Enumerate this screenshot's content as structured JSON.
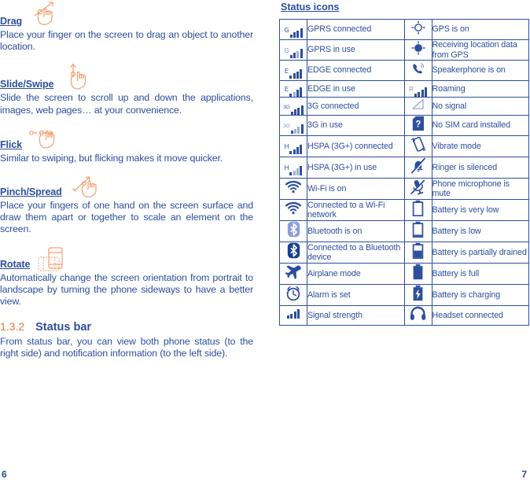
{
  "left_column": {
    "sections": [
      {
        "id": "drag",
        "term": "Drag",
        "icon": "drag-gesture-icon",
        "body": "Place your finger on the screen to drag an object to another location."
      },
      {
        "id": "slide-swipe",
        "term": "Slide/Swipe",
        "icon": "slide-swipe-gesture-icon",
        "body": "Slide the screen to scroll up and down the applications, images, web pages… at your convenience."
      },
      {
        "id": "flick",
        "term": "Flick",
        "icon": "flick-gesture-icon",
        "body": "Similar to swiping, but flicking makes it move quicker."
      },
      {
        "id": "pinch-spread",
        "term": "Pinch/Spread",
        "icon": "pinch-spread-gesture-icon",
        "body": "Place your fingers of one hand on the screen surface and draw them apart or together to scale an element on the screen."
      },
      {
        "id": "rotate",
        "term": "Rotate",
        "icon": "rotate-gesture-icon",
        "body": "Automatically change the screen orientation from portrait to landscape by turning the phone sideways to have a better view."
      }
    ],
    "subsection": {
      "number": "1.3.2",
      "title": "Status bar",
      "body": "From status bar, you can view both phone status (to the right side) and notification information (to the left side)."
    }
  },
  "right_column": {
    "heading": "Status icons",
    "table_rows": [
      {
        "left_icon": "gprs-connected-icon",
        "left_label": "GPRS connected",
        "right_icon": "gps-on-icon",
        "right_label": "GPS is on"
      },
      {
        "left_icon": "gprs-in-use-icon",
        "left_label": "GPRS in use",
        "right_icon": "gps-receiving-icon",
        "right_label": "Receiving location data from GPS"
      },
      {
        "left_icon": "edge-connected-icon",
        "left_label": "EDGE connected",
        "right_icon": "speakerphone-icon",
        "right_label": "Speakerphone is on"
      },
      {
        "left_icon": "edge-in-use-icon",
        "left_label": "EDGE in use",
        "right_icon": "roaming-icon",
        "right_label": "Roaming"
      },
      {
        "left_icon": "3g-connected-icon",
        "left_label": "3G connected",
        "right_icon": "no-signal-icon",
        "right_label": "No signal"
      },
      {
        "left_icon": "3g-in-use-icon",
        "left_label": "3G in use",
        "right_icon": "no-sim-card-icon",
        "right_label": "No SIM card installed"
      },
      {
        "left_icon": "hspa-connected-icon",
        "left_label": "HSPA (3G+) connected",
        "right_icon": "vibrate-mode-icon",
        "right_label": "Vibrate mode"
      },
      {
        "left_icon": "hspa-in-use-icon",
        "left_label": "HSPA (3G+) in use",
        "right_icon": "ringer-silenced-icon",
        "right_label": "Ringer is silenced"
      },
      {
        "left_icon": "wifi-on-icon",
        "left_label": "Wi-Fi is on",
        "right_icon": "microphone-mute-icon",
        "right_label": "Phone microphone is mute"
      },
      {
        "left_icon": "wifi-connected-icon",
        "left_label": "Connected to a Wi-Fi network",
        "right_icon": "battery-very-low-icon",
        "right_label": "Battery is very low"
      },
      {
        "left_icon": "bluetooth-on-icon",
        "left_label": "Bluetooth is on",
        "right_icon": "battery-low-icon",
        "right_label": "Battery is low"
      },
      {
        "left_icon": "bluetooth-connected-icon",
        "left_label": "Connected to a Bluetooth device",
        "right_icon": "battery-partial-icon",
        "right_label": "Battery is partially drained"
      },
      {
        "left_icon": "airplane-mode-icon",
        "left_label": "Airplane mode",
        "right_icon": "battery-full-icon",
        "right_label": "Battery is full"
      },
      {
        "left_icon": "alarm-set-icon",
        "left_label": "Alarm is set",
        "right_icon": "battery-charging-icon",
        "right_label": "Battery is charging"
      },
      {
        "left_icon": "signal-strength-icon",
        "left_label": "Signal strength",
        "right_icon": "headset-connected-icon",
        "right_label": "Headset connected"
      }
    ]
  },
  "footer": {
    "page_left": "6",
    "page_right": "7"
  },
  "colors": {
    "text_blue": "#2d4f9e",
    "accent_orange": "#e8763a",
    "gesture_line": "#f0a070",
    "bluetooth_light": "#8e9fd4"
  }
}
